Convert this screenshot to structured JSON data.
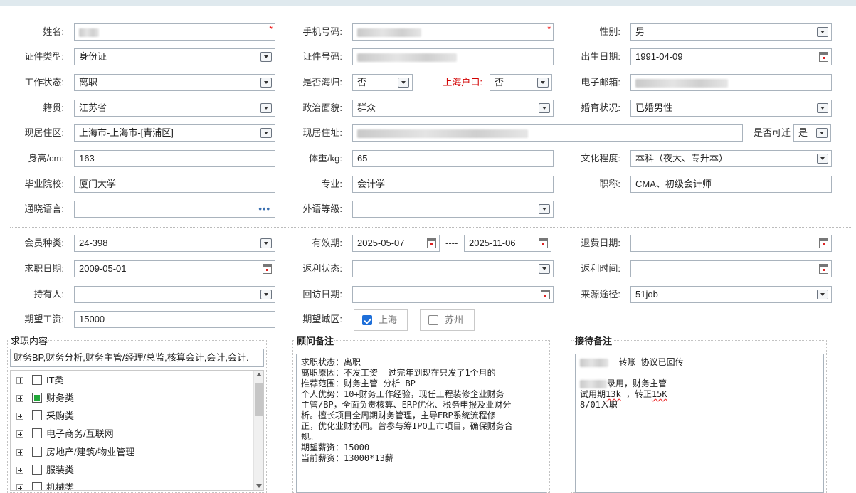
{
  "labels": {
    "name": "姓名:",
    "mobile": "手机号码:",
    "gender": "性别:",
    "id_type": "证件类型:",
    "id_no": "证件号码:",
    "birth": "出生日期:",
    "work_status": "工作状态:",
    "returnee": "是否海归:",
    "sh_hukou": "上海户口:",
    "email": "电子邮箱:",
    "native": "籍贯:",
    "political": "政治面貌:",
    "marital": "婚育状况:",
    "cur_area": "现居住区:",
    "cur_addr": "现居住址:",
    "relocate": "是否可迁",
    "height": "身高/cm:",
    "weight": "体重/kg:",
    "education": "文化程度:",
    "school": "毕业院校:",
    "major": "专业:",
    "title": "职称:",
    "language": "通晓语言:",
    "foreign_level": "外语等级:",
    "member_type": "会员种类:",
    "valid": "有效期:",
    "refund_date": "退费日期:",
    "job_date": "求职日期:",
    "rebate_status": "返利状态:",
    "rebate_time": "返利时间:",
    "holder": "持有人:",
    "visit_date": "回访日期:",
    "source": "来源途径:",
    "expect_salary": "期望工资:",
    "expect_city": "期望城区:"
  },
  "values": {
    "gender": "男",
    "id_type": "身份证",
    "birth": "1991-04-09",
    "work_status": "离职",
    "returnee": "否",
    "sh_hukou": "否",
    "native": "江苏省",
    "political": "群众",
    "marital": "已婚男性",
    "cur_area": "上海市-上海市-[青浦区]",
    "relocate": "是",
    "height": "163",
    "weight": "65",
    "education": "本科（夜大、专升本）",
    "school": "厦门大学",
    "major": "会计学",
    "title": "CMA、初级会计师",
    "member_type": "24-398",
    "valid_from": "2025-05-07",
    "valid_sep": "----",
    "valid_to": "2025-11-06",
    "job_date": "2009-05-01",
    "source": "51job",
    "expect_salary": "15000",
    "required_mark": "*",
    "more": "•••"
  },
  "cities": [
    {
      "label": "上海",
      "checked": true
    },
    {
      "label": "苏州",
      "checked": false
    }
  ],
  "sections": {
    "job_content": "求职内容",
    "advisor_note": "顾问备注",
    "reception_note": "接待备注"
  },
  "job_content_value": "财务BP,财务分析,财务主管/经理/总监,核算会计,会计,会计.",
  "tree": [
    {
      "label": "IT类",
      "partial": false
    },
    {
      "label": "财务类",
      "partial": true
    },
    {
      "label": "采购类",
      "partial": false
    },
    {
      "label": "电子商务/互联网",
      "partial": false
    },
    {
      "label": "房地产/建筑/物业管理",
      "partial": false
    },
    {
      "label": "服装类",
      "partial": false
    },
    {
      "label": "机械类",
      "partial": false
    }
  ],
  "advisor_note_lines": [
    "求职状态：离职",
    "离职原因：不发工资  过完年到现在只发了1个月的",
    "推荐范围：财务主管 分析 BP",
    "个人优势：10+财务工作经验，现任工程装修企业财务",
    "主管/BP，全面负责核算、ERP优化、税务申报及业财分",
    "析。擅长项目全周期财务管理，主导ERP系统流程修",
    "正，优化业财协同。曾参与筹IPO上市项目，确保财务合",
    "规。",
    "期望薪资：15000",
    "当前薪资：13000*13薪"
  ],
  "reception_note": {
    "line1": "转账 协议已回传",
    "line2": "录用，财务主管",
    "line3a": "试用期",
    "line3b": "13k",
    "line3c": " ，转正",
    "line3d": "15K",
    "line4": "8/01入职"
  },
  "colors": {
    "accent_red": "#d20000",
    "checkbox_blue": "#1e6fd9",
    "tree_partial_green": "#22a83a",
    "more_dots": "#3a6fb0"
  }
}
